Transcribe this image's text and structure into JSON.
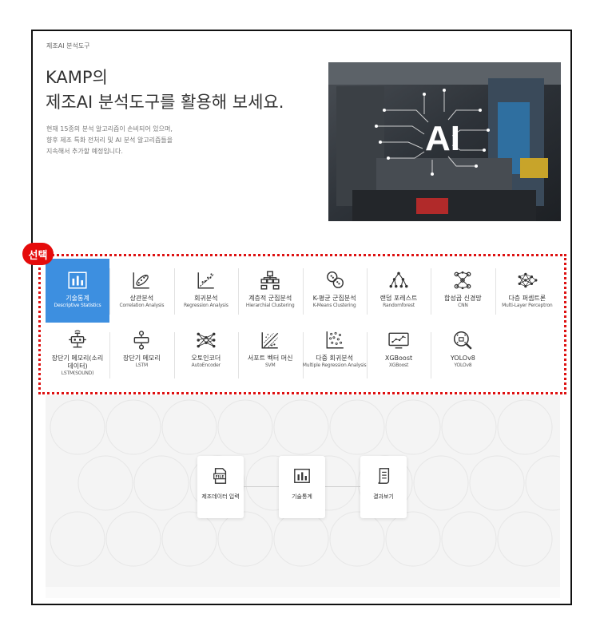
{
  "breadcrumb": "제조AI 분석도구",
  "hero": {
    "title_line1": "KAMP의",
    "title_line2": "제조AI 분석도구를 활용해 보세요.",
    "desc_line1": "현재 15종의 분석 알고리즘이 손비되어 있으며,",
    "desc_line2": "향후 제조 특화 전처리 및 AI 분석 알고리즘들을",
    "desc_line3": "지속해서 추가할 예정입니다.",
    "image_text": "AI"
  },
  "annotation": {
    "badge": "선택"
  },
  "tools": [
    {
      "ko": "기술통계",
      "en": "Descriptive Statistics",
      "icon": "bar-chart-icon",
      "active": true
    },
    {
      "ko": "상관분석",
      "en": "Correlation Analysis",
      "icon": "correlation-icon"
    },
    {
      "ko": "회귀분석",
      "en": "Regression Analysis",
      "icon": "regression-icon"
    },
    {
      "ko": "계층적 군집분석",
      "en": "Hierarchial Clustering",
      "icon": "hierarchy-icon"
    },
    {
      "ko": "K-평균 군집분석",
      "en": "K-Means Clustering",
      "icon": "kmeans-icon"
    },
    {
      "ko": "랜덤 포레스트",
      "en": "Randomforest",
      "icon": "tree-icon"
    },
    {
      "ko": "합성곱 신경망",
      "en": "CNN",
      "icon": "cnn-icon"
    },
    {
      "ko": "다층 퍼셉트론",
      "en": "Multi-Layer Perceptron",
      "icon": "mlp-icon"
    },
    {
      "ko": "장단기 메모리(소리 데이터)",
      "en": "LSTM(SOUND)",
      "icon": "lstm-sound-icon"
    },
    {
      "ko": "장단기 메모리",
      "en": "LSTM",
      "icon": "lstm-icon"
    },
    {
      "ko": "오토인코더",
      "en": "AutoEncoder",
      "icon": "autoencoder-icon"
    },
    {
      "ko": "서포트 벡터 머신",
      "en": "SVM",
      "icon": "svm-icon"
    },
    {
      "ko": "다중 회귀분석",
      "en": "Multiple Regression Analysis",
      "icon": "multi-regression-icon"
    },
    {
      "ko": "XGBoost",
      "en": "XGBoost",
      "icon": "xgboost-icon"
    },
    {
      "ko": "YOLOv8",
      "en": "YOLOv8",
      "icon": "yolo-icon"
    }
  ],
  "flow": [
    {
      "label": "제조데이터 입력",
      "icon": "file-icon"
    },
    {
      "label": "기술통계",
      "icon": "bar-chart-icon"
    },
    {
      "label": "결과보기",
      "icon": "document-icon"
    }
  ],
  "colors": {
    "active": "#3d8fe0",
    "annotation": "#e50b0b"
  }
}
